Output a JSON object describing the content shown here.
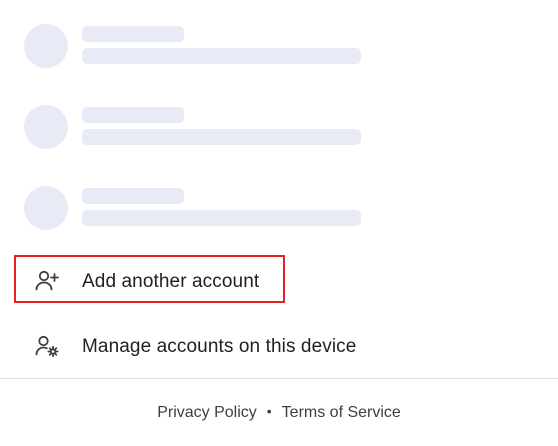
{
  "accounts_loading": [
    {
      "state": "loading"
    },
    {
      "state": "loading"
    },
    {
      "state": "loading"
    }
  ],
  "actions": {
    "add_account": {
      "label": "Add another account",
      "icon": "add-person-icon"
    },
    "manage_accounts": {
      "label": "Manage accounts on this device",
      "icon": "manage-accounts-icon"
    }
  },
  "footer": {
    "privacy_label": "Privacy Policy",
    "separator": "•",
    "terms_label": "Terms of Service"
  },
  "colors": {
    "skeleton": "#e8eaf6",
    "highlight": "#e02424",
    "text": "#202124",
    "divider": "#e0e0e0"
  }
}
